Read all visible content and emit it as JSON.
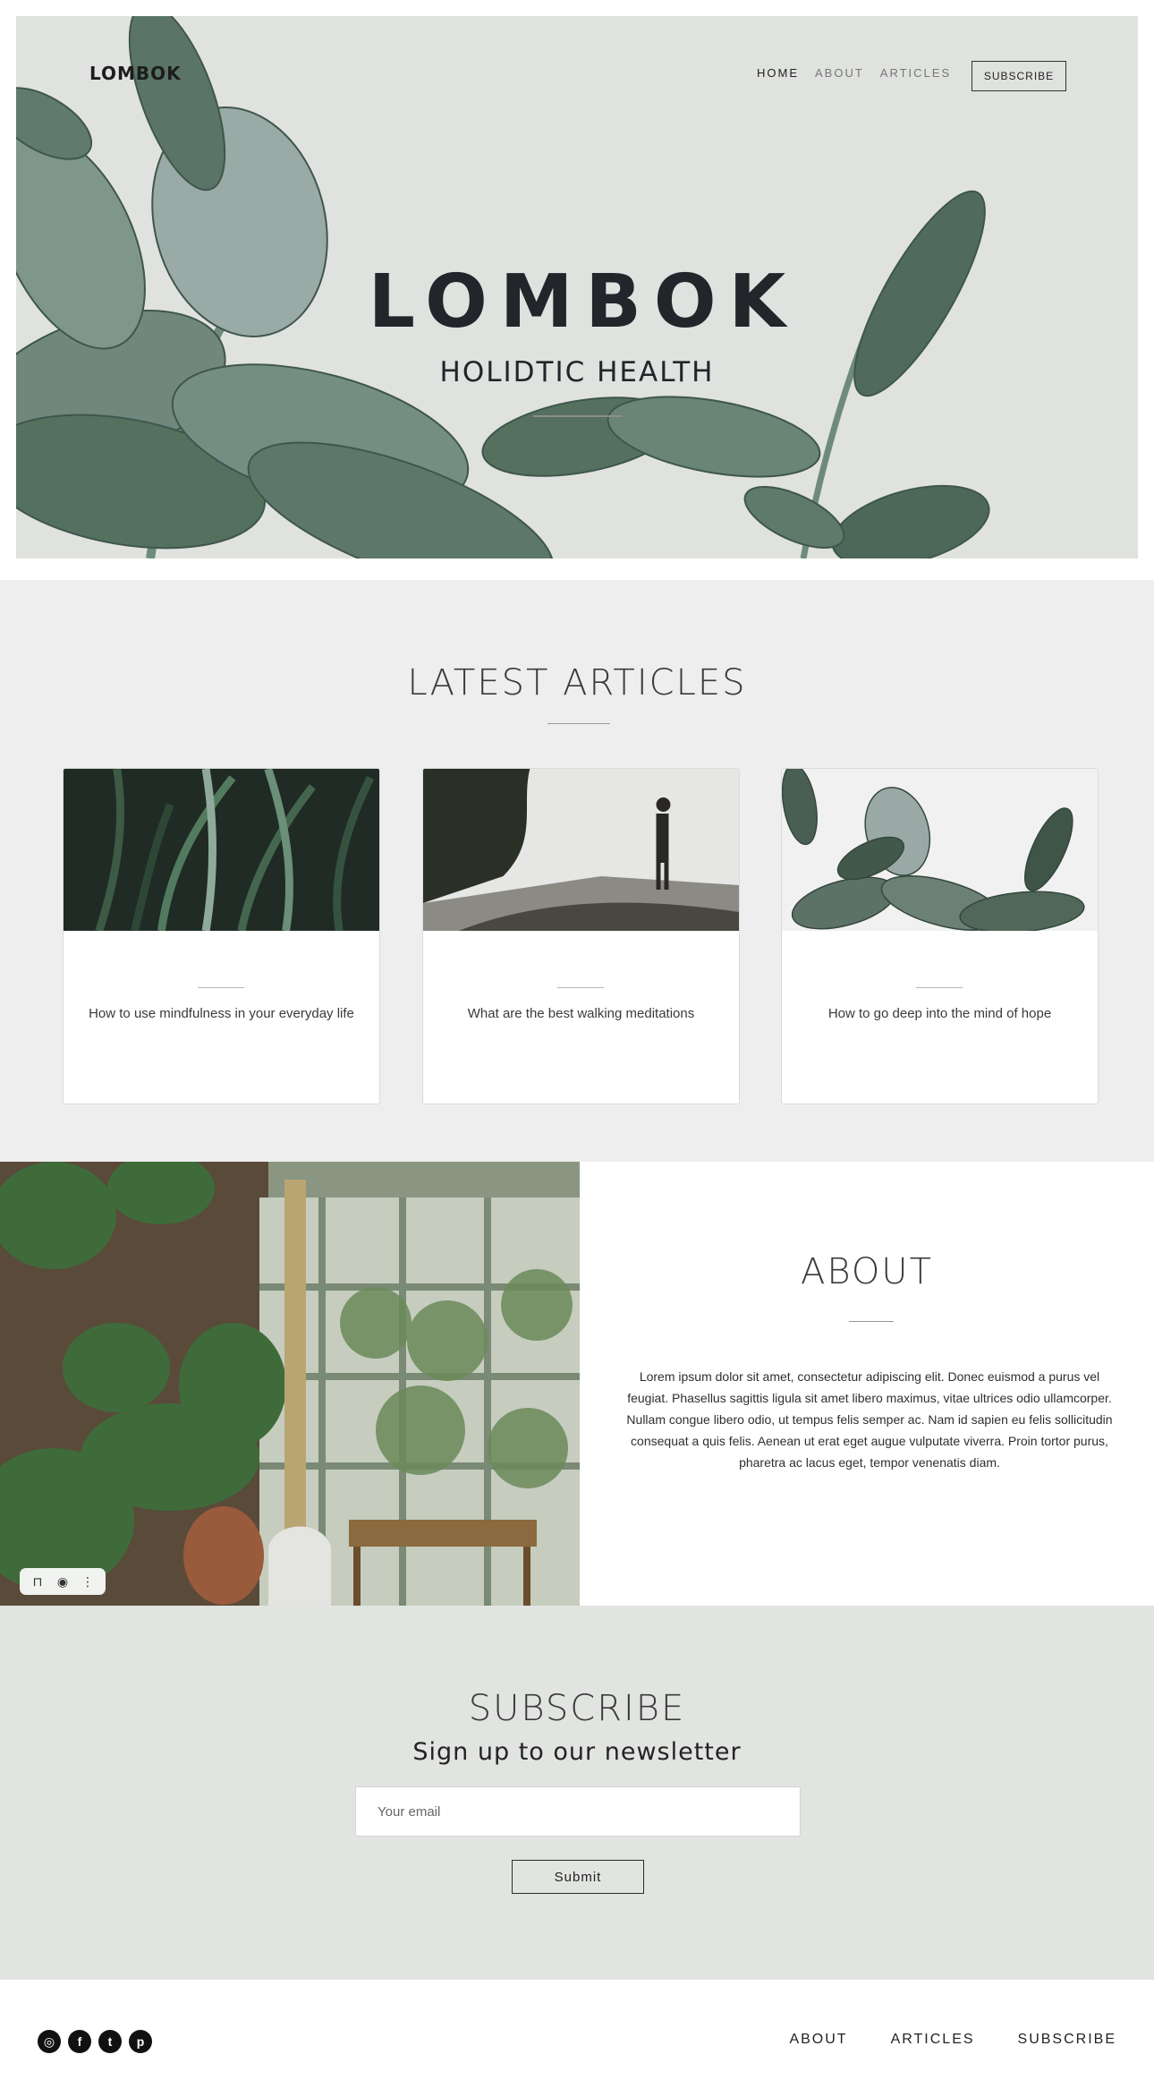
{
  "header": {
    "brand": "LOMBOK",
    "nav": [
      {
        "label": "HOME"
      },
      {
        "label": "ABOUT"
      },
      {
        "label": "ARTICLES"
      }
    ],
    "subscribe_label": "SUBSCRIBE"
  },
  "hero": {
    "title": "LOMBOK",
    "subtitle": "HOLIDTIC HEALTH"
  },
  "latest": {
    "title": "LATEST ARTICLES",
    "articles": [
      {
        "title": "How to use mindfulness in your everyday life"
      },
      {
        "title": "What are the best walking meditations"
      },
      {
        "title": "How to go deep into the mind of hope"
      }
    ]
  },
  "about": {
    "title": "ABOUT",
    "body": "Lorem ipsum dolor sit amet, consectetur adipiscing elit. Donec euismod a purus vel feugiat. Phasellus sagittis ligula sit amet libero maximus, vitae ultrices odio ullamcorper. Nullam congue libero odio, ut tempus felis semper ac. Nam id sapien eu felis sollicitudin consequat a quis felis. Aenean ut erat eget augue vulputate viverra. Proin tortor purus, pharetra ac lacus eget, tempor venenatis diam."
  },
  "subscribe": {
    "title": "SUBSCRIBE",
    "heading": "Sign up to our newsletter",
    "email_placeholder": "Your email",
    "submit_label": "Submit"
  },
  "footer": {
    "socials": [
      {
        "icon": "instagram-icon",
        "glyph": "◎"
      },
      {
        "icon": "facebook-icon",
        "glyph": "f"
      },
      {
        "icon": "twitter-icon",
        "glyph": "t"
      },
      {
        "icon": "pinterest-icon",
        "glyph": "p"
      }
    ],
    "nav": [
      {
        "label": "ABOUT"
      },
      {
        "label": "ARTICLES"
      },
      {
        "label": "SUBSCRIBE"
      }
    ]
  }
}
